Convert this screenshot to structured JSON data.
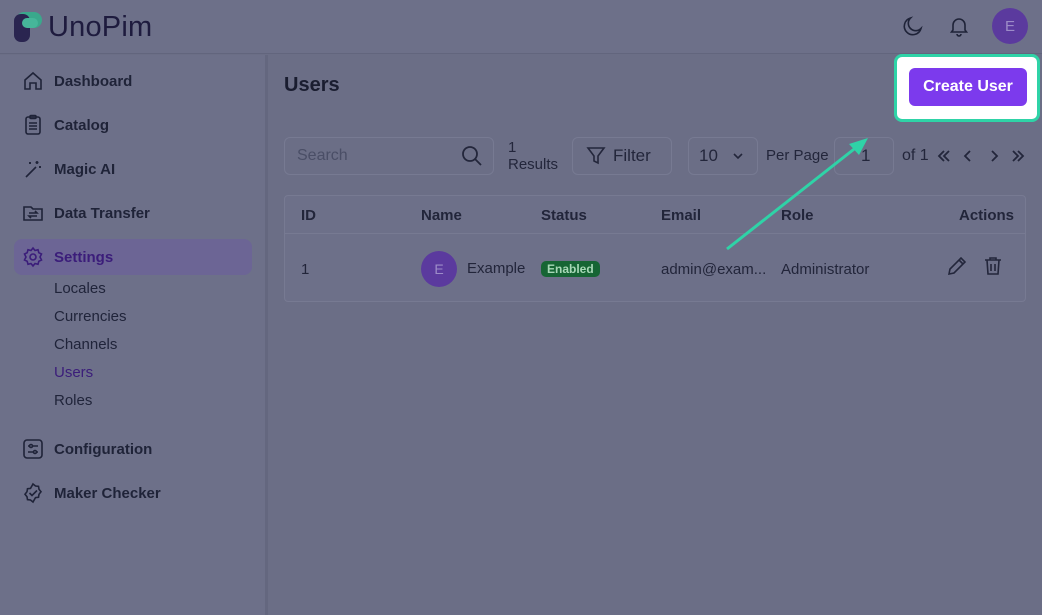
{
  "brand": {
    "name": "UnoPim"
  },
  "header": {
    "avatar_initial": "E"
  },
  "sidebar": {
    "items": [
      {
        "label": "Dashboard"
      },
      {
        "label": "Catalog"
      },
      {
        "label": "Magic AI"
      },
      {
        "label": "Data Transfer"
      },
      {
        "label": "Settings"
      },
      {
        "label": "Configuration"
      },
      {
        "label": "Maker Checker"
      }
    ],
    "settings_sub": [
      {
        "label": "Locales"
      },
      {
        "label": "Currencies"
      },
      {
        "label": "Channels"
      },
      {
        "label": "Users"
      },
      {
        "label": "Roles"
      }
    ]
  },
  "main": {
    "title": "Users",
    "create_button": "Create User",
    "search_placeholder": "Search",
    "results_count": "1",
    "results_label": "Results",
    "filter_label": "Filter",
    "per_page_value": "10",
    "per_page_label": "Per Page",
    "page_value": "1",
    "page_of": "of 1"
  },
  "table": {
    "columns": [
      "ID",
      "Name",
      "Status",
      "Email",
      "Role",
      "Actions"
    ],
    "rows": [
      {
        "id": "1",
        "avatar_initial": "E",
        "name": "Example",
        "status": "Enabled",
        "email": "admin@exam...",
        "role": "Administrator"
      }
    ]
  },
  "colors": {
    "accent": "#7c3aed",
    "highlight": "#2fd3a7",
    "status_enabled": "#166534"
  }
}
